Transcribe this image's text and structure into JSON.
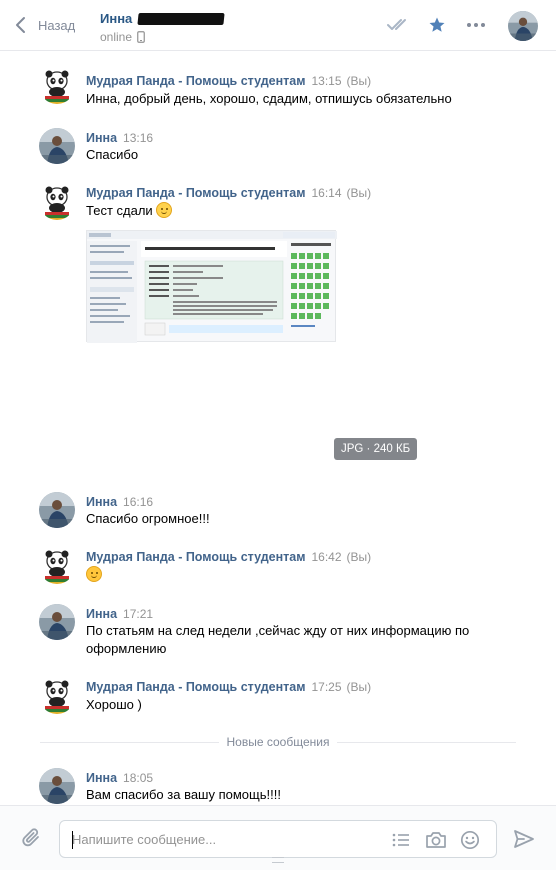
{
  "header": {
    "back_label": "Назад",
    "peer_name": "Инна",
    "peer_status": "online"
  },
  "messages": [
    {
      "author": "Мудрая Панда - Помощь студентам",
      "time": "13:15",
      "you_label": "(Вы)",
      "text": "Инна, добрый день, хорошо, сдадим, отпишусь обязательно"
    },
    {
      "author": "Инна",
      "time": "13:16",
      "text": "Спасибо"
    },
    {
      "author": "Мудрая Панда - Помощь студентам",
      "time": "16:14",
      "you_label": "(Вы)",
      "text": "Тест сдали"
    },
    {
      "author": "Инна",
      "time": "16:16",
      "text": "Спасибо огромное!!!"
    },
    {
      "author": "Мудрая Панда - Помощь студентам",
      "time": "16:42",
      "you_label": "(Вы)",
      "text": ""
    },
    {
      "author": "Инна",
      "time": "17:21",
      "text": "По статьям на след недели ,сейчас жду от них информацию по оформлению"
    },
    {
      "author": "Мудрая Панда - Помощь студентам",
      "time": "17:25",
      "you_label": "(Вы)",
      "text": "Хорошо )"
    },
    {
      "author": "Инна",
      "time": "18:05",
      "text": "Вам спасибо за вашу помощь!!!!"
    }
  ],
  "attachment": {
    "badge": "JPG · 240 КБ",
    "screenshot_title": "Итоговый междисциплинарный экзамен. Выпускное сопровождение обучающихся",
    "nav_title": "Навигация по тесту"
  },
  "divider_label": "Новые сообщения",
  "composer": {
    "placeholder": "Напишите сообщение..."
  },
  "icons": {
    "back": "chevron-left-icon",
    "read": "double-check-icon",
    "star": "star-icon",
    "more": "more-dots-icon",
    "attach": "paperclip-icon",
    "templates": "list-icon",
    "camera": "camera-icon",
    "emoji": "smile-icon",
    "send": "send-arrow-icon"
  },
  "colors": {
    "link": "#2a5885",
    "author": "#42648b",
    "muted": "#939393",
    "accent": "#5181b8",
    "border": "#e7e8ec"
  }
}
